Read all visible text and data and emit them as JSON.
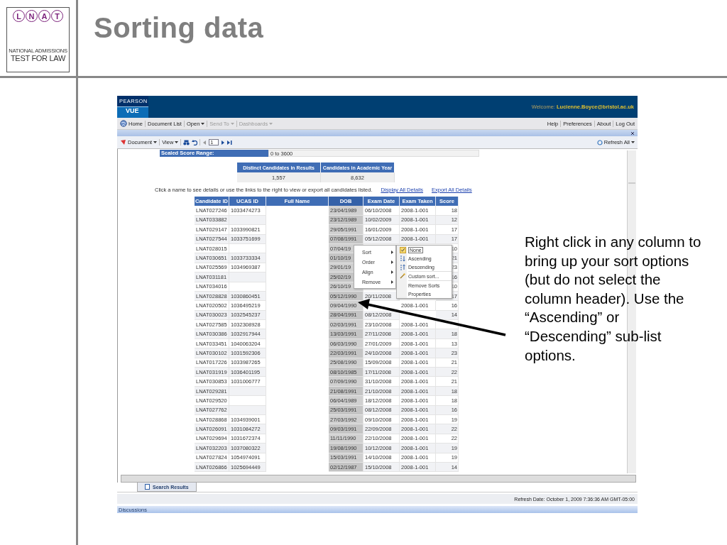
{
  "slide": {
    "logo": {
      "letters": [
        "L",
        "N",
        "A",
        "T"
      ],
      "line_1": "NATIONAL ADMISSIONS",
      "line_2": "TEST FOR LAW"
    },
    "title": "Sorting data"
  },
  "app": {
    "brand": {
      "top": "PEARSON",
      "bottom": "VUE"
    },
    "welcome_label": "Welcome:",
    "user": "Lucienne.Boyce@bristol.ac.uk",
    "nav_left": [
      {
        "label": "Home",
        "kind": "home",
        "disabled": false
      },
      {
        "label": "Document List",
        "kind": "plain",
        "disabled": false
      },
      {
        "label": "Open",
        "kind": "menu",
        "disabled": false
      },
      {
        "label": "Send To",
        "kind": "menu",
        "disabled": true
      },
      {
        "label": "Dashboards",
        "kind": "menu",
        "disabled": true
      }
    ],
    "nav_right": [
      "Help",
      "Preferences",
      "About",
      "Log Out"
    ],
    "toolbar": {
      "document": "Document",
      "view": "View",
      "page": "1",
      "refresh": "Refresh All"
    },
    "report": {
      "range_label": "Scaled Score Range:",
      "range_value": "0 to 3600",
      "summary": {
        "columns": [
          "Distinct Candidates in Results",
          "Candidates in Academic Year"
        ],
        "values": [
          "1,557",
          "8,632"
        ]
      },
      "instruction": "Click a name to see details or use the links to the right to view or export all candidates listed.",
      "links": [
        "Display All Details",
        "Export All Details"
      ],
      "table": {
        "columns": [
          {
            "label": "Candidate ID",
            "selected": false
          },
          {
            "label": "UCAS ID",
            "selected": false
          },
          {
            "label": "Full Name",
            "selected": false
          },
          {
            "label": "DOB",
            "selected": true
          },
          {
            "label": "Exam Date",
            "selected": false
          },
          {
            "label": "Exam Taken",
            "selected": false
          },
          {
            "label": "Score",
            "selected": false
          }
        ],
        "rows": [
          {
            "id": "LNAT027246",
            "ucas": "1033474273",
            "dob": "23/04/1989",
            "exam_date": "06/10/2008",
            "exam_taken": "2008-1-001",
            "score": "18"
          },
          {
            "id": "LNAT033882",
            "dob": "23/12/1989",
            "exam_date": "10/02/2009",
            "exam_taken": "2008-1-001",
            "score": "12"
          },
          {
            "id": "LNAT029147",
            "ucas": "1033990821",
            "dob": "29/05/1991",
            "exam_date": "16/01/2009",
            "exam_taken": "2008-1-001",
            "score": "17"
          },
          {
            "id": "LNAT027544",
            "ucas": "1033751699",
            "dob": "07/08/1991",
            "exam_date": "05/12/2008",
            "exam_taken": "2008-1-001",
            "score": "17"
          },
          {
            "id": "LNAT028015",
            "dob": "07/04/19",
            "score": "10"
          },
          {
            "id": "LNAT030651",
            "ucas": "1033733334",
            "dob": "01/10/19",
            "score": "21"
          },
          {
            "id": "LNAT025569",
            "ucas": "1034969387",
            "dob": "29/01/19",
            "score": "23"
          },
          {
            "id": "LNAT031181",
            "dob": "25/02/19",
            "score": "16"
          },
          {
            "id": "LNAT034016",
            "dob": "26/10/19",
            "score": "10"
          },
          {
            "id": "LNAT028828",
            "ucas": "1030860451",
            "dob": "05/12/1990",
            "exam_date": "20/11/2008",
            "score": "17"
          },
          {
            "id": "LNAT020502",
            "ucas": "1036495219",
            "dob": "09/04/1990",
            "exam_taken": "2008-1-001",
            "score": "16"
          },
          {
            "id": "LNAT030023",
            "ucas": "1032545237",
            "dob": "28/04/1991",
            "exam_date": "08/12/2008",
            "score": "14"
          },
          {
            "id": "LNAT027585",
            "ucas": "1032308928",
            "dob": "02/03/1991",
            "exam_date": "23/10/2008",
            "exam_taken": "2008-1-001"
          },
          {
            "id": "LNAT030386",
            "ucas": "1032917944",
            "dob": "13/03/1991",
            "exam_date": "27/11/2008",
            "exam_taken": "2008-1-001",
            "score": "18"
          },
          {
            "id": "LNAT033451",
            "ucas": "1040063204",
            "dob": "06/03/1990",
            "exam_date": "27/01/2009",
            "exam_taken": "2008-1-001",
            "score": "13"
          },
          {
            "id": "LNAT030102",
            "ucas": "1031592306",
            "dob": "22/03/1991",
            "exam_date": "24/10/2008",
            "exam_taken": "2008-1-001",
            "score": "23"
          },
          {
            "id": "LNAT017226",
            "ucas": "1033987265",
            "dob": "25/08/1990",
            "exam_date": "15/09/2008",
            "exam_taken": "2008-1-001",
            "score": "21"
          },
          {
            "id": "LNAT031919",
            "ucas": "1036401195",
            "dob": "08/10/1985",
            "exam_date": "17/11/2008",
            "exam_taken": "2008-1-001",
            "score": "22"
          },
          {
            "id": "LNAT030853",
            "ucas": "1031006777",
            "dob": "07/09/1990",
            "exam_date": "31/10/2008",
            "exam_taken": "2008-1-001",
            "score": "21"
          },
          {
            "id": "LNAT029281",
            "dob": "21/08/1991",
            "exam_date": "21/10/2008",
            "exam_taken": "2008-1-001",
            "score": "18"
          },
          {
            "id": "LNAT029520",
            "dob": "06/04/1989",
            "exam_date": "18/12/2008",
            "exam_taken": "2008-1-001",
            "score": "18"
          },
          {
            "id": "LNAT027762",
            "dob": "25/03/1991",
            "exam_date": "08/12/2008",
            "exam_taken": "2008-1-001",
            "score": "16"
          },
          {
            "id": "LNAT028868",
            "ucas": "1034939001",
            "dob": "27/03/1992",
            "exam_date": "09/10/2008",
            "exam_taken": "2008-1-001",
            "score": "19"
          },
          {
            "id": "LNAT026091",
            "ucas": "1031084272",
            "dob": "09/03/1991",
            "exam_date": "22/09/2008",
            "exam_taken": "2008-1-001",
            "score": "22"
          },
          {
            "id": "LNAT029694",
            "ucas": "1031672374",
            "dob": "11/11/1990",
            "exam_date": "22/10/2008",
            "exam_taken": "2008-1-001",
            "score": "22"
          },
          {
            "id": "LNAT032203",
            "ucas": "1037080322",
            "dob": "19/08/1990",
            "exam_date": "10/12/2008",
            "exam_taken": "2008-1-001",
            "score": "19"
          },
          {
            "id": "LNAT027824",
            "ucas": "1054974091",
            "dob": "15/03/1991",
            "exam_date": "14/10/2008",
            "exam_taken": "2008-1-001",
            "score": "19"
          },
          {
            "id": "LNAT026866",
            "ucas": "1025694449",
            "dob": "02/12/1987",
            "exam_date": "15/10/2008",
            "exam_taken": "2008-1-001",
            "score": "14"
          }
        ]
      }
    },
    "context_menu": {
      "items": [
        "Sort",
        "Order",
        "Align",
        "Remove"
      ],
      "submenu": [
        {
          "label": "None",
          "kind": "option",
          "checked": true
        },
        {
          "label": "Ascending",
          "kind": "ascending",
          "checked": false
        },
        {
          "label": "Descending",
          "kind": "descending",
          "checked": false
        },
        {
          "label": "Custom sort...",
          "kind": "custom",
          "checked": false
        },
        {
          "label": "Remove Sorts",
          "kind": "plain",
          "checked": false
        },
        {
          "label": "Properties",
          "kind": "plain",
          "checked": false
        }
      ]
    },
    "tabs": [
      {
        "label": "Search Results",
        "selected": true
      }
    ],
    "status": "Refresh Date: October 1, 2009 7:36:36 AM GMT-05:00",
    "discussions": "Discussions"
  },
  "note": "Right click in any column to bring up your sort options (but do not select the column header). Use the “Ascending” or “Descending” sub-list options."
}
